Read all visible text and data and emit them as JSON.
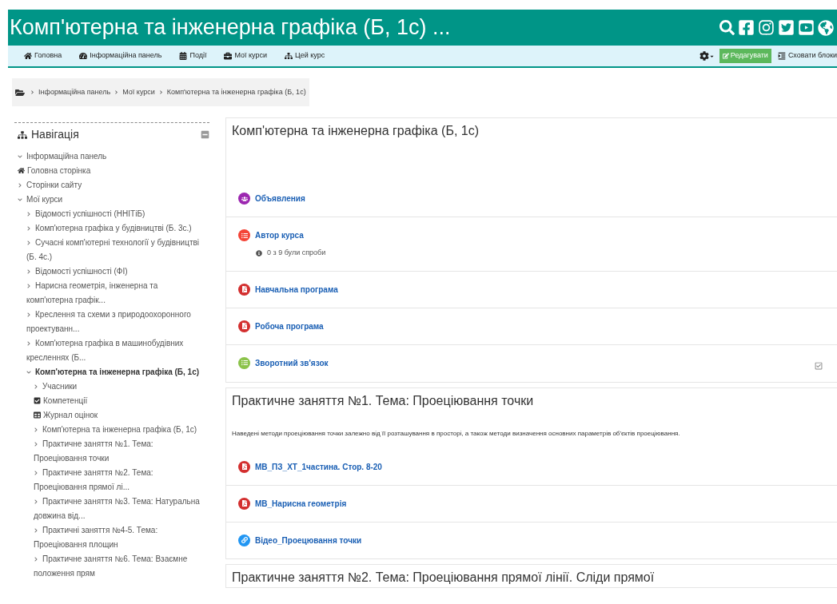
{
  "header": {
    "title": "Комп'ютерна та інженерна графіка (Б, 1с) ..."
  },
  "navbar": {
    "items": [
      {
        "kind": "home",
        "label": "Головна"
      },
      {
        "kind": "dashboard",
        "label": "Інформаційна панель"
      },
      {
        "kind": "calendar",
        "label": "Події"
      },
      {
        "kind": "courses",
        "label": "Мої курси"
      },
      {
        "kind": "course",
        "label": "Цей курс"
      }
    ],
    "edit_button": "Редагувати",
    "hide_blocks": "Сховати блоки"
  },
  "breadcrumb": [
    "Інформаційна панель",
    "Мої курси",
    "Комп'ютерна та інженерна графіка (Б, 1с)"
  ],
  "navigation": {
    "title": "Навігація",
    "items": [
      {
        "kind": "branch",
        "label": "Інформаційна панель",
        "expanded": true,
        "selected": false
      },
      {
        "kind": "home",
        "label": "Головна сторінка",
        "selected": false
      },
      {
        "kind": "branch",
        "label": "Сторінки сайту",
        "expanded": false,
        "selected": false
      },
      {
        "kind": "branch",
        "label": "Мої курси",
        "expanded": true,
        "selected": false,
        "children": [
          {
            "kind": "branch",
            "label": "Відомості успішності (ННІТіБ)",
            "expanded": false,
            "selected": false
          },
          {
            "kind": "branch",
            "label": "Комп'ютерна графіка у будівництві (Б. 3с.)",
            "expanded": false,
            "selected": false
          },
          {
            "kind": "branch",
            "label": "Сучасні комп'ютерні технології у будівництві (Б. 4с.)",
            "expanded": false,
            "selected": false
          },
          {
            "kind": "branch",
            "label": "Відомості успішності (ФІ)",
            "expanded": false,
            "selected": false
          },
          {
            "kind": "branch",
            "label": "Нарисна геометрія, інженерна та комп'ютерна графік...",
            "expanded": false,
            "selected": false
          },
          {
            "kind": "branch",
            "label": "Креслення та схеми з природоохоронного проектуванн...",
            "expanded": false,
            "selected": false
          },
          {
            "kind": "branch",
            "label": "Комп'ютерна графіка в машинобудівних кресленнях (Б...",
            "expanded": false,
            "selected": false
          },
          {
            "kind": "branch",
            "label": "Комп'ютерна та інженерна графіка (Б, 1с)",
            "expanded": true,
            "selected": true,
            "children": [
              {
                "kind": "branch",
                "label": "Учасники",
                "expanded": false,
                "selected": false
              },
              {
                "kind": "competencies",
                "label": "Компетенції",
                "selected": false
              },
              {
                "kind": "grades",
                "label": "Журнал оцінок",
                "selected": false
              },
              {
                "kind": "branch",
                "label": "Комп'ютерна та інженерна графіка (Б, 1с)",
                "expanded": false,
                "selected": false
              },
              {
                "kind": "branch",
                "label": "Практичне заняття №1. Тема: Проеціювання точки",
                "expanded": false,
                "selected": false
              },
              {
                "kind": "branch",
                "label": "Практичне заняття №2. Тема: Проеціювання прямої лі...",
                "expanded": false,
                "selected": false
              },
              {
                "kind": "branch",
                "label": "Практичне заняття №3. Тема: Натуральна довжина від...",
                "expanded": false,
                "selected": false
              },
              {
                "kind": "branch",
                "label": "Практичні заняття №4-5. Тема: Проеціювання площин",
                "expanded": false,
                "selected": false
              },
              {
                "kind": "branch",
                "label": "Практичне заняття №6. Тема: Взаємне положення прям",
                "expanded": false,
                "selected": false
              }
            ]
          }
        ]
      }
    ]
  },
  "sections": [
    {
      "title": "Комп'ютерна та інженерна графіка (Б, 1с)",
      "activities": [
        {
          "kind": "forum",
          "name": "Объявления",
          "completion_box": false
        },
        {
          "kind": "quiz",
          "name": "Автор курса",
          "info": "0 з 9 були спроби",
          "completion_box": false
        },
        {
          "kind": "pdf",
          "name": "Навчальна програма",
          "completion_box": false
        },
        {
          "kind": "pdf",
          "name": "Робоча програма",
          "completion_box": false
        },
        {
          "kind": "feedback",
          "name": "Зворотний зв'язок",
          "completion_box": true
        }
      ]
    },
    {
      "title": "Практичне заняття №1. Тема: Проеціювання точки",
      "summary": "Наведені методи проеціювання точки залежно від її розташування в просторі, а також методи визначення основних параметрів об'єктів  проеціювання.",
      "activities": [
        {
          "kind": "pdf",
          "name": "МВ_ПЗ_ХТ_1частина. Стор. 8-20",
          "completion_box": false
        },
        {
          "kind": "pdf",
          "name": "МВ_Нарисна геометрія",
          "completion_box": false
        },
        {
          "kind": "url",
          "name": "Відео_Проецювання точки",
          "completion_box": false
        }
      ]
    },
    {
      "title": "Практичне заняття №2. Тема: Проеціювання прямої лінії. Сліди прямої"
    }
  ]
}
